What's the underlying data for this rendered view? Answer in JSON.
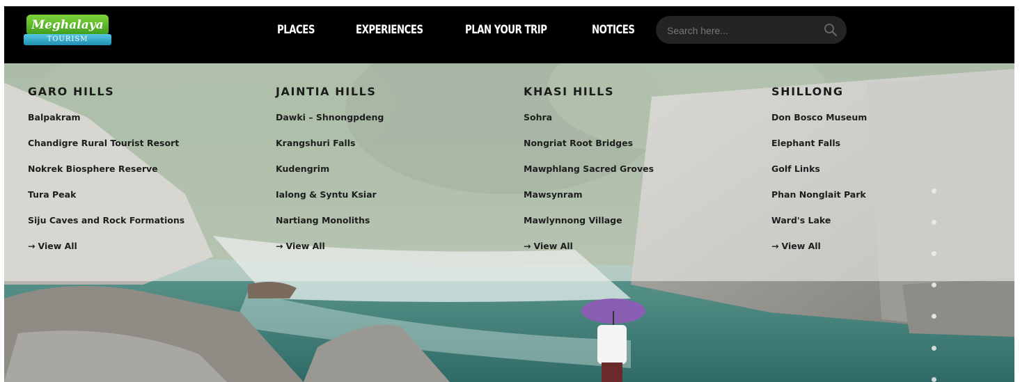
{
  "header": {
    "logo": {
      "script_text": "Meghalaya",
      "ribbon_text": "TOURISM"
    },
    "nav": [
      "PLACES",
      "EXPERIENCES",
      "PLAN YOUR TRIP",
      "NOTICES"
    ],
    "search": {
      "placeholder": "Search here...",
      "icon": "search-icon"
    }
  },
  "mega_menu": {
    "columns": [
      {
        "title": "GARO HILLS",
        "links": [
          "Balpakram",
          "Chandigre Rural Tourist Resort",
          "Nokrek Biosphere Reserve",
          "Tura Peak",
          "Siju Caves and Rock Formations"
        ],
        "view_all": "View All"
      },
      {
        "title": "JAINTIA HILLS",
        "links": [
          "Dawki – Shnongpdeng",
          "Krangshuri Falls",
          "Kudengrim",
          "Ialong & Syntu Ksiar",
          "Nartiang Monoliths"
        ],
        "view_all": "View All"
      },
      {
        "title": "KHASI HILLS",
        "links": [
          "Sohra",
          "Nongriat Root Bridges",
          "Mawphlang Sacred Groves",
          "Mawsynram",
          "Mawlynnong Village"
        ],
        "view_all": "View All"
      },
      {
        "title": "SHILLONG",
        "links": [
          "Don Bosco Museum",
          "Elephant Falls",
          "Golf Links",
          "Phan Nonglait Park",
          "Ward's Lake"
        ],
        "view_all": "View All"
      }
    ]
  },
  "colors": {
    "header_bg": "#000000",
    "overlay": "rgba(236,236,232,0.62)",
    "text_dark": "#1e1e1e",
    "logo_green": "#5cb82a",
    "logo_blue": "#2aa0c4"
  }
}
